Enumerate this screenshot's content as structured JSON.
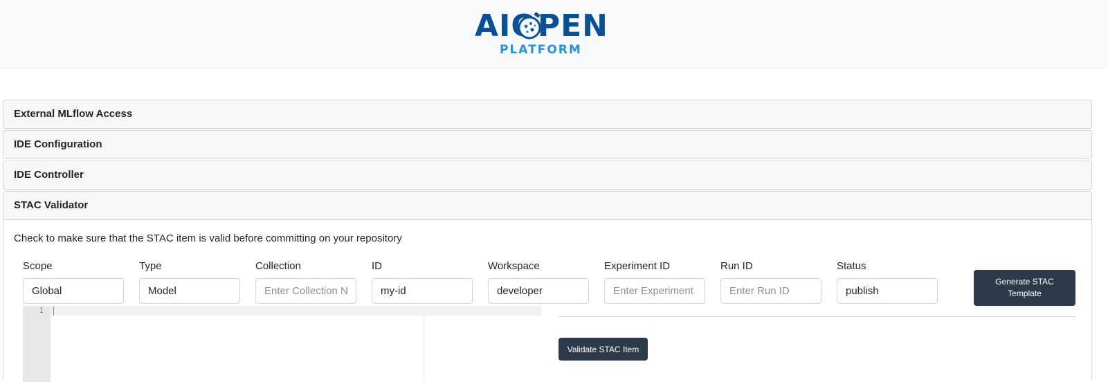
{
  "header": {
    "logo_main": "AIOPEN",
    "logo_sub": "PLATFORM",
    "brand_colors": {
      "primary": "#0b4f95",
      "accent": "#2a8fd8"
    },
    "logo_icon": "satellite-globe-icon"
  },
  "accordion": {
    "items": [
      {
        "title": "External MLflow Access"
      },
      {
        "title": "IDE Configuration"
      },
      {
        "title": "IDE Controller"
      },
      {
        "title": "STAC Validator"
      }
    ]
  },
  "stac": {
    "description": "Check to make sure that the STAC item is valid before committing on your repository",
    "fields": {
      "scope": {
        "label": "Scope",
        "value": "Global",
        "placeholder": ""
      },
      "type": {
        "label": "Type",
        "value": "Model",
        "placeholder": ""
      },
      "collection": {
        "label": "Collection",
        "value": "",
        "placeholder": "Enter Collection Name"
      },
      "id": {
        "label": "ID",
        "value": "my-id",
        "placeholder": ""
      },
      "workspace": {
        "label": "Workspace",
        "value": "developer",
        "placeholder": ""
      },
      "experiment": {
        "label": "Experiment ID",
        "value": "",
        "placeholder": "Enter Experiment ID"
      },
      "run": {
        "label": "Run ID",
        "value": "",
        "placeholder": "Enter Run ID"
      },
      "status": {
        "label": "Status",
        "value": "publish",
        "placeholder": ""
      }
    },
    "generate_label": "Generate STAC Template",
    "validate_label": "Validate STAC Item",
    "editor": {
      "line_number": "1",
      "content": ""
    },
    "button_color": "#2d3a4a"
  }
}
